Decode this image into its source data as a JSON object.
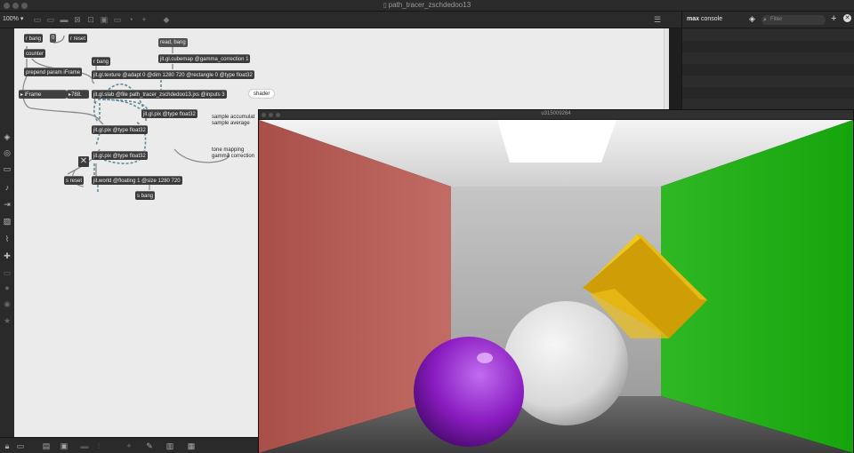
{
  "window": {
    "title": "path_tracer_zschdedoo13"
  },
  "toolbar": {
    "zoom": "100% ▾"
  },
  "patch": {
    "objects": {
      "r_bang_1": "r bang",
      "zero_msg": "0",
      "r_reset": "r reset",
      "counter": "counter",
      "prepend": "prepend param iFrame",
      "r_bang_2": "r bang",
      "read_bang": "read, bang",
      "cubemap": "jit.gl.cubemap @gamma_correction 1",
      "texture": "jit.gl.texture @adapt 0 @dim 1280 720 @rectangle 0 @type float32",
      "iframe_label": "iFrame",
      "iframe_value": "788.",
      "slab": "jit.gl.slab @file path_tracer_zschdedoo13.jxs @inputs 3",
      "pix_upper": "jit.gl.pix @type float32",
      "pix_left": "jit.gl.pix @type float32",
      "pix_tone": "jit.gl.pix @type float32",
      "s_reset": "s reset",
      "world": "jit.world @floating 1 @size 1280 720",
      "s_bang": "s bang"
    },
    "comments": {
      "shader": "shader",
      "sample_line1": "sample accumulat",
      "sample_line2": "sample average",
      "tone_line1": "tone mapping",
      "tone_line2": "gamma correction"
    }
  },
  "console": {
    "title_bold": "max",
    "title_rest": " console",
    "filter_placeholder": "Filter"
  },
  "render_window": {
    "title": "u315009264"
  },
  "scene_colors": {
    "red_wall": "#b5524d",
    "green_wall": "#1fb114",
    "back_wall": "#dcdcdc",
    "purple_sphere": "#8a1cc0",
    "yellow_cube": "#e0b60a"
  }
}
